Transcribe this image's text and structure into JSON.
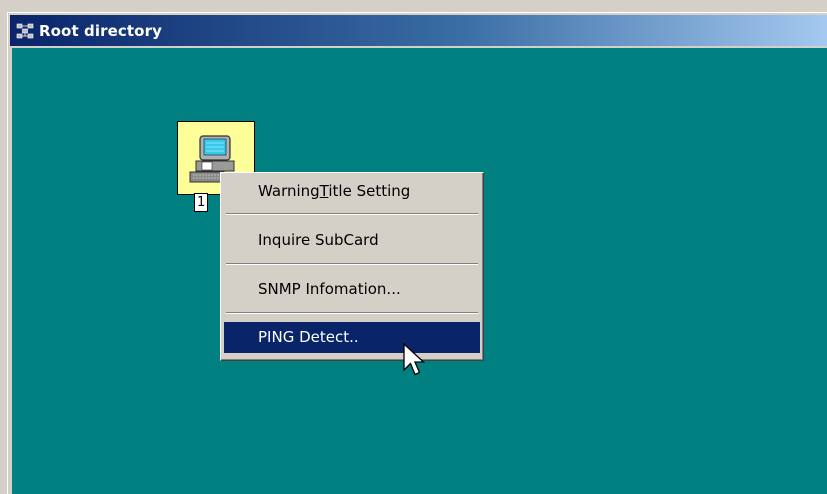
{
  "window": {
    "title": "Root directory",
    "title_icon": "network-nodes-icon"
  },
  "canvas": {
    "background_color": "#008080",
    "node": {
      "icon": "computer-terminal-icon",
      "caption": "1",
      "highlight_color": "#ffff99"
    }
  },
  "context_menu": {
    "items": [
      {
        "label_before": "Warning",
        "mnemonic": "T",
        "label_after": "itle Setting"
      },
      {
        "label": "Inquire SubCard"
      },
      {
        "label": "SNMP Infomation..."
      },
      {
        "label": "PING Detect..",
        "highlighted": true
      }
    ]
  },
  "cursor": {
    "icon": "arrow-pointer-icon"
  }
}
